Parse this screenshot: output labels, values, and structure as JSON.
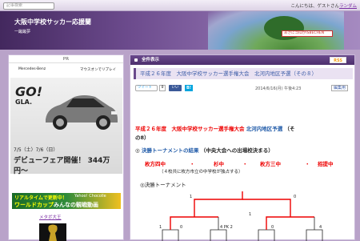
{
  "topbar": {
    "search_placeholder": "記事検索",
    "greeting": "こんにちは、ゲストさん",
    "random_label": "ランダム"
  },
  "header": {
    "site_title": "大阪中学校サッカー応援蘭",
    "site_subtitle": "一蹴蹴夢",
    "notice": "あきにゴIDがISBECHEN"
  },
  "sidebar": {
    "pr_label": "PR",
    "ad": {
      "brand": "Mercedes-Benz",
      "brand_right": "マウスオンでリプレイ",
      "go": "GO!",
      "gla": "GLA.",
      "dates": "7/5（土）7/6（日）",
      "fair": "デビューフェア開催！ 344万円〜"
    },
    "news": {
      "line1": "リアルタイムで更新中！",
      "line1b": "Yahoo! Chocolle",
      "line2_a": "ワールドカップ",
      "line2_b": "みんなの観戦動画"
    },
    "meta_label": "メタボ大王"
  },
  "content": {
    "tab_label": "全件表示",
    "rss_label": "RSS",
    "post_title": "平成２６年度　大阪中学校サッカー選手権大会　北河内地区予選（その８）",
    "tweet_label": "ツイート",
    "tweet_count": "0",
    "fb_label": "いいね！",
    "hatena_label": "B!",
    "post_date": "2014/6/16(月) 午後4:23",
    "edit_label": "編集用",
    "headline_red": "平成２６年度　大阪中学校サッカー選手権大会",
    "headline_blue": "北河内地区予選",
    "headline_black": "（そ",
    "headline_line2": "の8）",
    "section_mark": "◎",
    "section_title": "決勝トーナメントの結果",
    "section_sub": "（中央大会への出場校決まる）",
    "schools": [
      "枚方四中",
      "・",
      "杉中",
      "・",
      "枚方三中",
      "・",
      "招提中"
    ],
    "note": "（４校共に枚方市立の中学校が独占する）",
    "bracket_label": "◎決勝トーナメント",
    "bracket_scores": [
      "1",
      "0",
      "1",
      "0",
      "1",
      "0",
      "4",
      "4 PK 2"
    ]
  },
  "colors": {
    "purple_dark": "#4d2f6d",
    "purple_header": "#6b4a8c",
    "accent_red": "#e00000",
    "accent_blue": "#1f5aa8",
    "link_purple": "#7a2fa3"
  }
}
